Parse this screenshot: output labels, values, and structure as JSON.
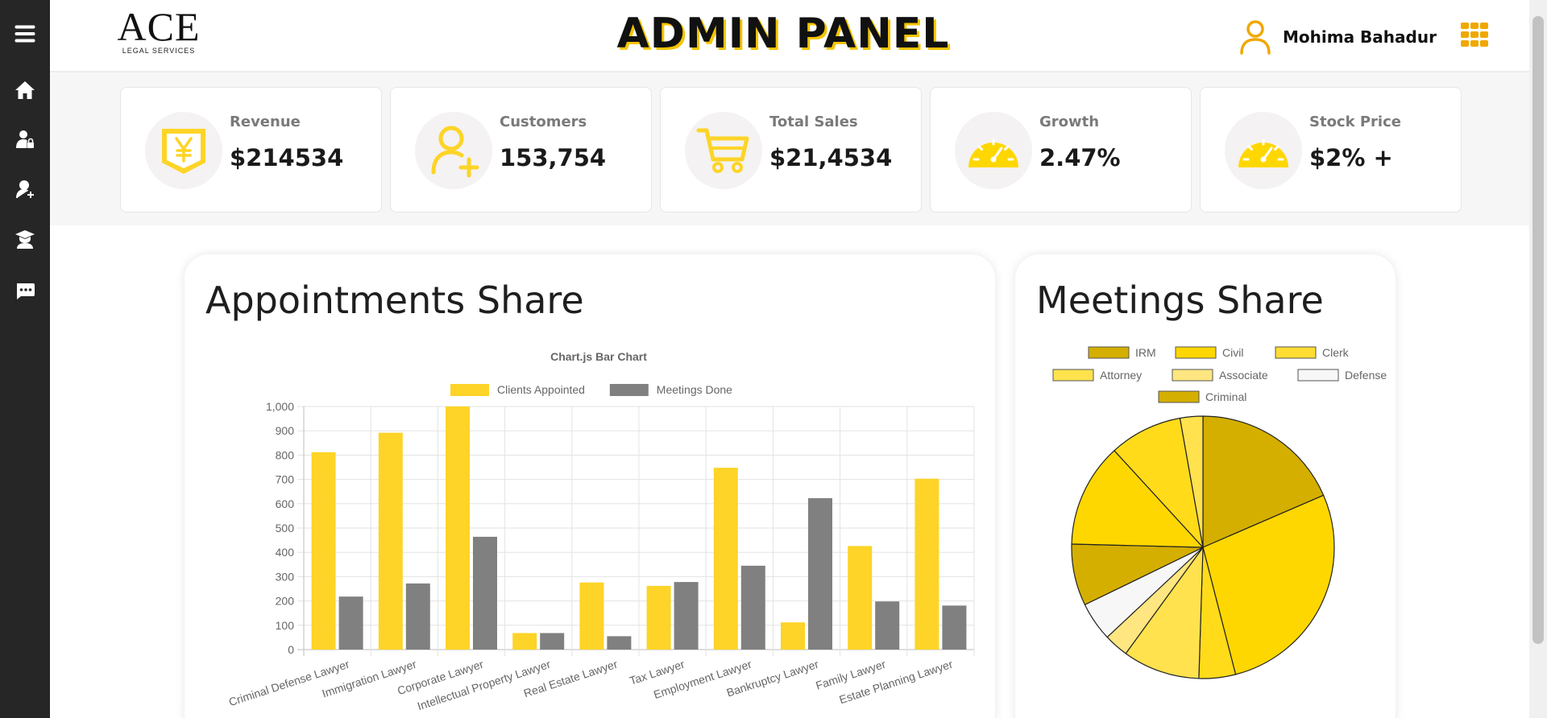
{
  "sidebar": {
    "items": [
      {
        "name": "menu-icon"
      },
      {
        "name": "home-icon"
      },
      {
        "name": "user-lock-icon"
      },
      {
        "name": "user-add-icon"
      },
      {
        "name": "graduate-icon"
      },
      {
        "name": "chat-icon"
      }
    ]
  },
  "header": {
    "logo_main": "ACE",
    "logo_sub": "LEGAL SERVICES",
    "title": "ADMIN PANEL",
    "user_name": "Mohima Bahadur",
    "accent": "#f5c400",
    "user_icon": "user-icon",
    "apps_icon": "grid-icon"
  },
  "stats": [
    {
      "label": "Revenue",
      "value": "$214534",
      "icon": "yen-icon"
    },
    {
      "label": "Customers",
      "value": "153,754",
      "icon": "user-plus-icon"
    },
    {
      "label": "Total Sales",
      "value": "$21,4534",
      "icon": "cart-icon"
    },
    {
      "label": "Growth",
      "value": "2.47%",
      "icon": "gauge-icon"
    },
    {
      "label": "Stock Price",
      "value": "$2% +",
      "icon": "gauge-icon"
    }
  ],
  "appointments": {
    "title": "Appointments Share"
  },
  "meetings": {
    "title": "Meetings Share"
  },
  "chart_data": [
    {
      "type": "bar",
      "title": "Chart.js Bar Chart",
      "categories": [
        "Criminal Defense Lawyer",
        "Immigration Lawyer",
        "Corporate Lawyer",
        "Intellectual Property Lawyer",
        "Real Estate Lawyer",
        "Tax Lawyer",
        "Employment Lawyer",
        "Bankruptcy Lawyer",
        "Family Lawyer",
        "Estate Planning Lawyer"
      ],
      "series": [
        {
          "name": "Clients Appointed",
          "color": "#fdd427",
          "values": [
            812,
            892,
            1000,
            68,
            276,
            262,
            748,
            112,
            426,
            703
          ]
        },
        {
          "name": "Meetings Done",
          "color": "#808080",
          "values": [
            218,
            272,
            464,
            68,
            55,
            278,
            345,
            623,
            198,
            181
          ]
        }
      ],
      "ylim": [
        0,
        1000
      ],
      "yticks": [
        "0",
        "100",
        "200",
        "300",
        "400",
        "500",
        "600",
        "700",
        "800",
        "900",
        "1,000"
      ],
      "grid": true,
      "legend": "top"
    },
    {
      "type": "pie",
      "legend": "top",
      "legend_items": [
        {
          "name": "IRM",
          "color": "#d4af00"
        },
        {
          "name": "Civil",
          "color": "#ffd700"
        },
        {
          "name": "Clerk",
          "color": "#ffdd33"
        },
        {
          "name": "Attorney",
          "color": "#ffe24d"
        },
        {
          "name": "Associate",
          "color": "#ffe680"
        },
        {
          "name": "Defense",
          "color": "#f7f7f7"
        },
        {
          "name": "Criminal",
          "color": "#d4af00"
        }
      ],
      "slices": [
        {
          "value": 18.5,
          "color": "#d4af00"
        },
        {
          "value": 27.5,
          "color": "#ffd700"
        },
        {
          "value": 4.5,
          "color": "#ffdb1a"
        },
        {
          "value": 9.5,
          "color": "#ffe24d"
        },
        {
          "value": 3.0,
          "color": "#ffe680"
        },
        {
          "value": 4.8,
          "color": "#f7f7f7"
        },
        {
          "value": 7.6,
          "color": "#d4af00"
        },
        {
          "value": 12.8,
          "color": "#ffd700"
        },
        {
          "value": 9.0,
          "color": "#ffdb1a"
        },
        {
          "value": 2.8,
          "color": "#ffe24d"
        }
      ]
    }
  ]
}
